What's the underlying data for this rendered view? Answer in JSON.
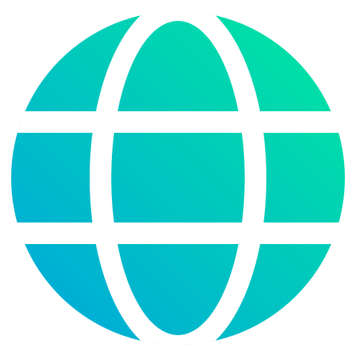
{
  "icon": {
    "name": "globe-icon",
    "colors": {
      "gradient_start": "#00a8dc",
      "gradient_end": "#00e6a0",
      "separator": "#ffffff",
      "background": "#ffffff"
    }
  }
}
